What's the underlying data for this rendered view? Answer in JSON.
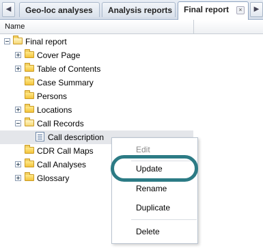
{
  "tabs": [
    {
      "label": "Geo-loc analyses"
    },
    {
      "label": "Analysis reports"
    },
    {
      "label": "Final report",
      "active": true
    }
  ],
  "nav": {
    "back_glyph": "◀",
    "forward_glyph": "▶",
    "menu_glyph": "▼",
    "close_glyph": "×"
  },
  "column_header": {
    "name": "Name"
  },
  "tree": {
    "root": "Final report",
    "items": [
      {
        "label": "Cover Page"
      },
      {
        "label": "Table of Contents"
      },
      {
        "label": "Case Summary"
      },
      {
        "label": "Persons"
      },
      {
        "label": "Locations"
      },
      {
        "label": "Call Records"
      },
      {
        "label": "Call description"
      },
      {
        "label": "CDR Call Maps"
      },
      {
        "label": "Call Analyses"
      },
      {
        "label": "Glossary"
      }
    ]
  },
  "context_menu": {
    "items": [
      {
        "label": "Edit"
      },
      {
        "label": "Update"
      },
      {
        "label": "Rename"
      },
      {
        "label": "Duplicate"
      },
      {
        "label": "Delete"
      }
    ]
  },
  "colors": {
    "highlight_ring": "#2c7b85",
    "selection": "#e4e6ea"
  }
}
